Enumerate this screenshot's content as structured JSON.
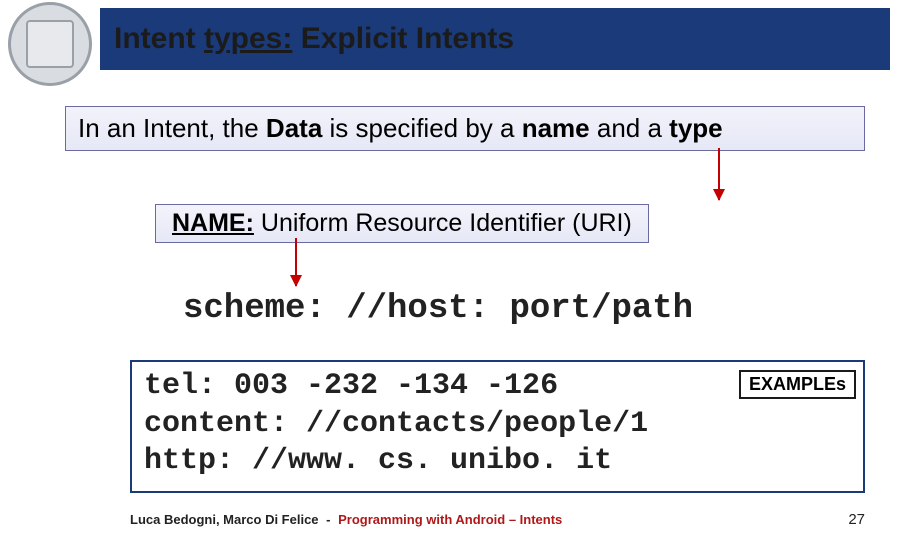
{
  "title": {
    "pre": "Intent ",
    "highlight": "types:",
    "post": " Explicit Intents"
  },
  "intro": {
    "t1": "In an Intent, the ",
    "b1": "Data",
    "t2": " is specified by a ",
    "b2": "name",
    "t3": " and a ",
    "b3": "type"
  },
  "name_box": {
    "label": "NAME:",
    "value": " Uniform Resource Identifier (URI)"
  },
  "scheme": "scheme: //host: port/path",
  "examples": {
    "label": "EXAMPLEs",
    "lines": [
      "tel: 003 -232 -134 -126",
      "content: //contacts/people/1",
      "http: //www. cs. unibo. it"
    ]
  },
  "footer": {
    "authors": "Luca Bedogni, Marco Di Felice",
    "dash": "-",
    "course": "Programming with Android – Intents",
    "page": "27"
  }
}
